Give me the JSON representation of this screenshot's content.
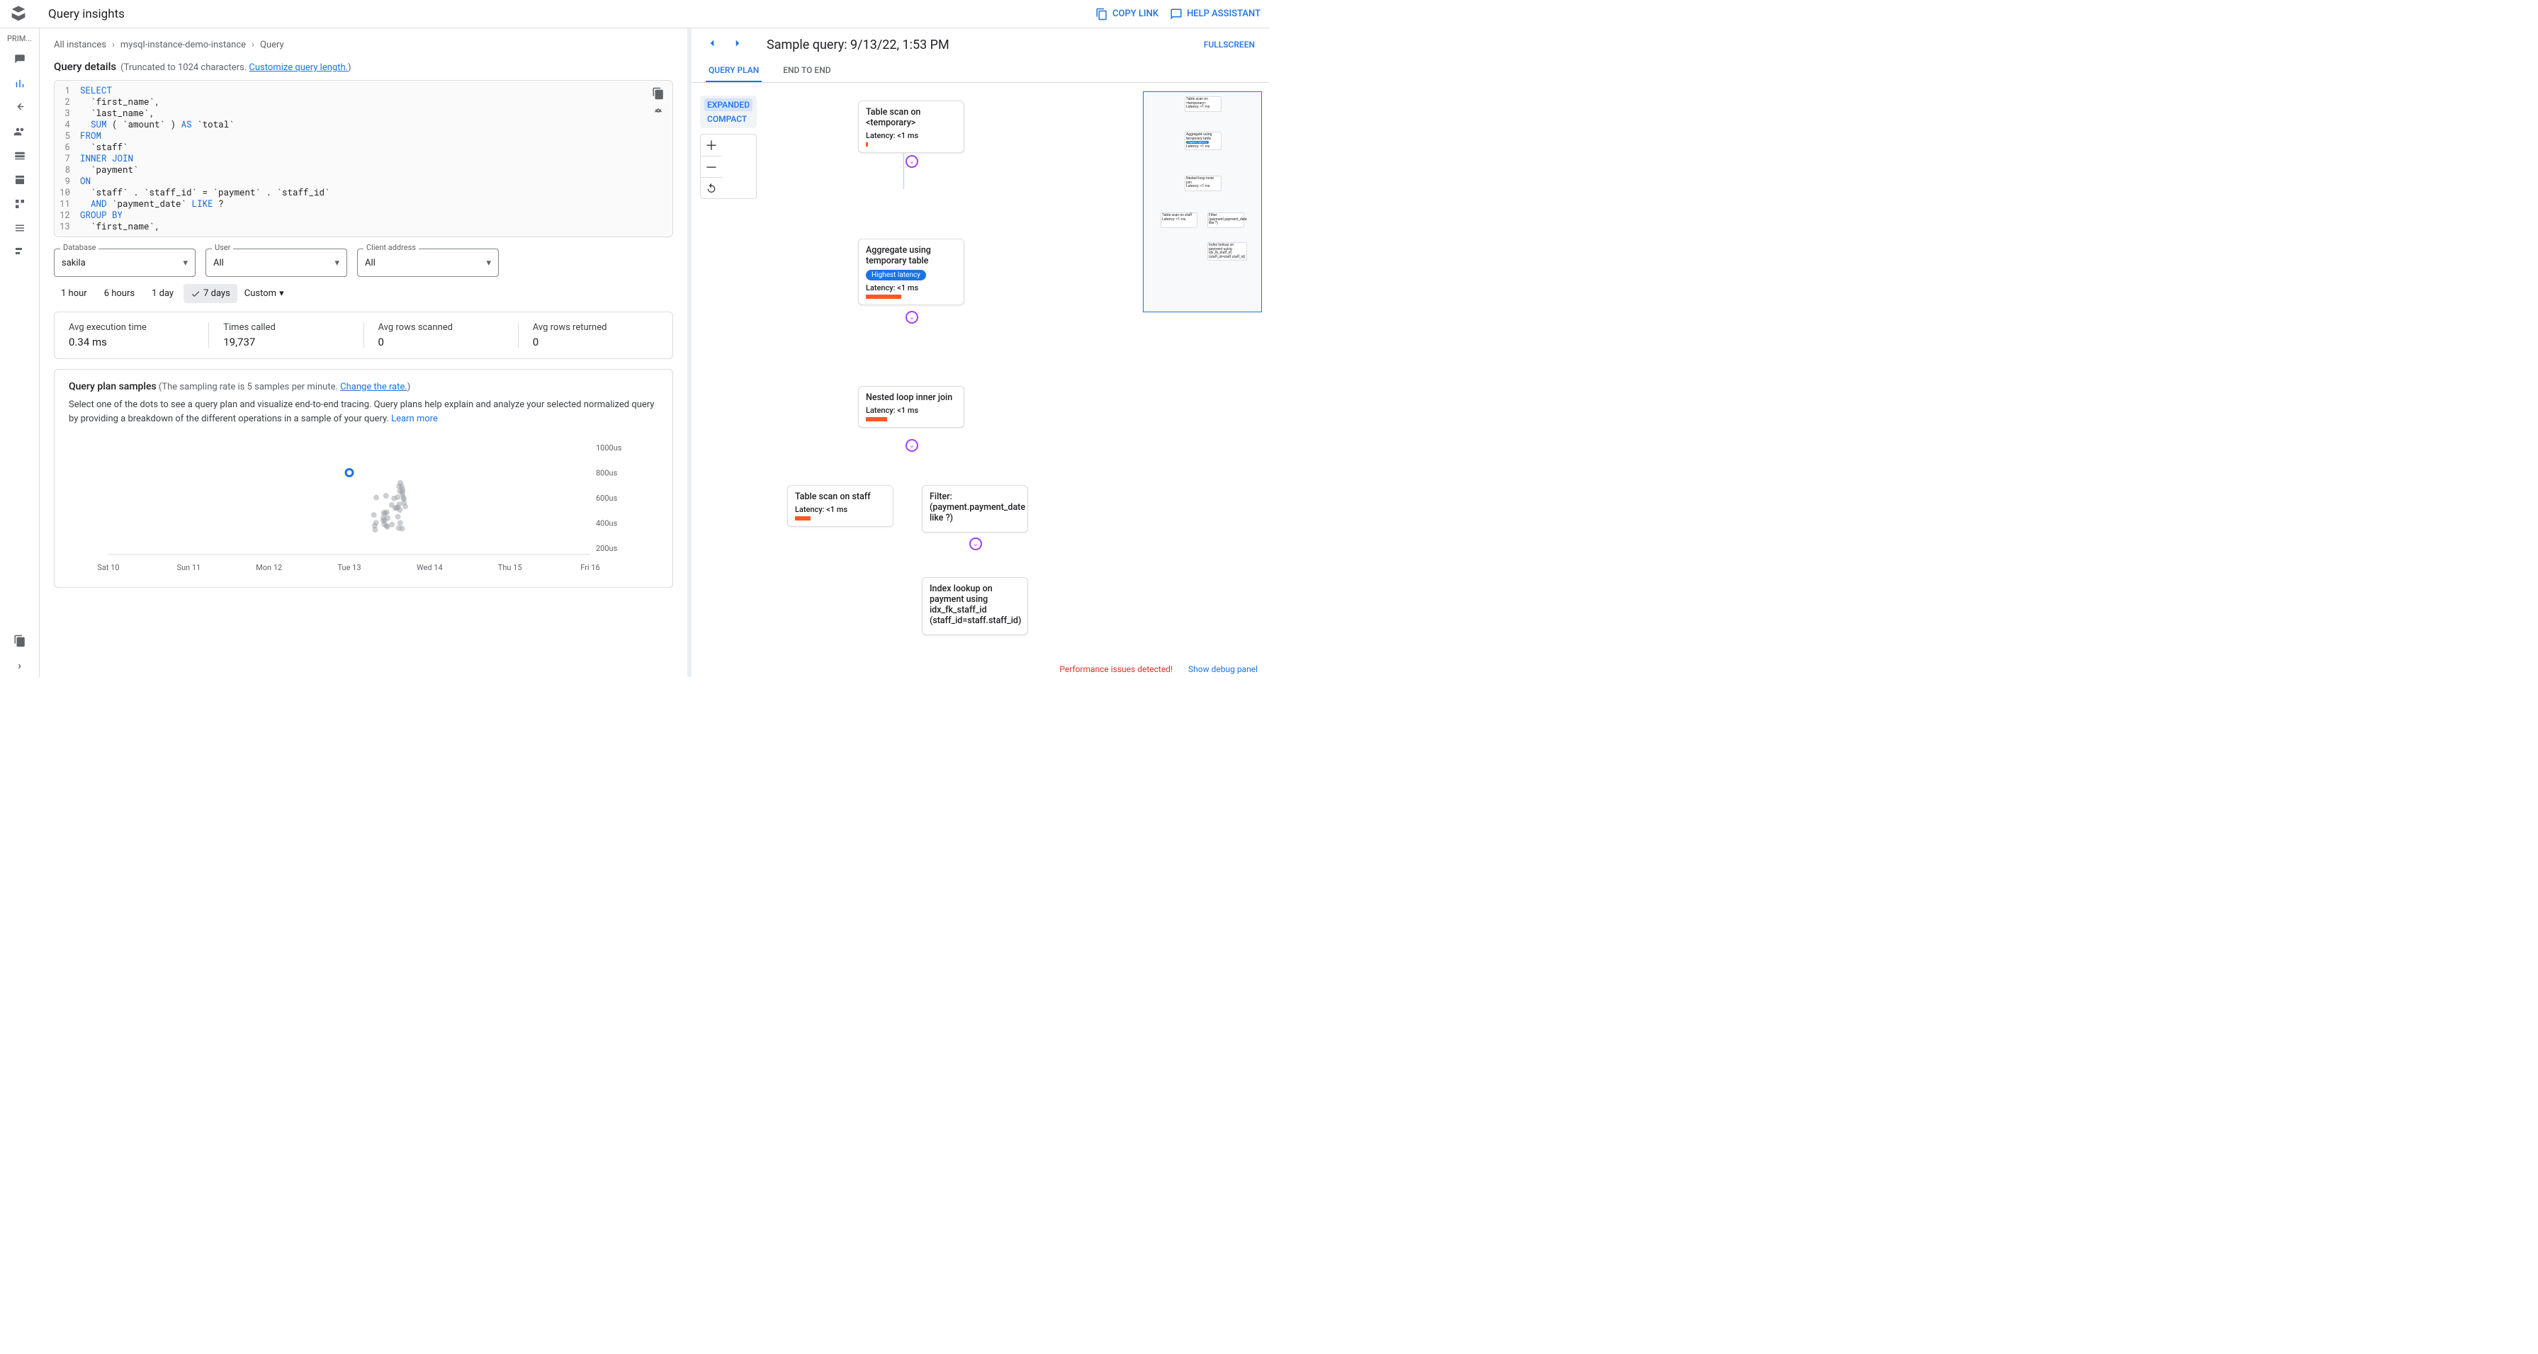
{
  "topbar": {
    "title": "Query insights",
    "copy": "COPY LINK",
    "help": "HELP ASSISTANT"
  },
  "sidebar": {
    "section": "PRIM...",
    "bottom_chev": "›"
  },
  "breadcrumb": {
    "all": "All instances",
    "inst": "mysql-instance-demo-instance",
    "q": "Query"
  },
  "qd": {
    "title": "Query details",
    "trunc": "(Truncated to 1024 characters. ",
    "customize": "Customize query length.",
    "close": ")"
  },
  "code": {
    "lines": [
      {
        "n": "1",
        "pre": "",
        "kw": "SELECT",
        "post": ""
      },
      {
        "n": "2",
        "pre": "  `first_name`,",
        "kw": "",
        "post": ""
      },
      {
        "n": "3",
        "pre": "  `last_name`,",
        "kw": "",
        "post": ""
      },
      {
        "n": "4",
        "pre": "  ",
        "kw": "SUM",
        "post": " ( `amount` ) ",
        "kw2": "AS",
        "post2": " `total`"
      },
      {
        "n": "5",
        "pre": "",
        "kw": "FROM",
        "post": ""
      },
      {
        "n": "6",
        "pre": "  `staff`",
        "kw": "",
        "post": ""
      },
      {
        "n": "7",
        "pre": "",
        "kw": "INNER JOIN",
        "post": ""
      },
      {
        "n": "8",
        "pre": "  `payment`",
        "kw": "",
        "post": ""
      },
      {
        "n": "9",
        "pre": "",
        "kw": "ON",
        "post": ""
      },
      {
        "n": "10",
        "pre": "  `staff` . `staff_id` = `payment` . `staff_id`",
        "kw": "",
        "post": ""
      },
      {
        "n": "11",
        "pre": "  ",
        "kw": "AND",
        "post": " `payment_date` ",
        "kw2": "LIKE",
        "post2": " ?"
      },
      {
        "n": "12",
        "pre": "",
        "kw": "GROUP BY",
        "post": ""
      },
      {
        "n": "13",
        "pre": "  `first_name`,",
        "kw": "",
        "post": ""
      }
    ]
  },
  "filters": {
    "db_label": "Database",
    "db_val": "sakila",
    "user_label": "User",
    "user_val": "All",
    "client_label": "Client address",
    "client_val": "All"
  },
  "timerow": {
    "h1": "1 hour",
    "h6": "6 hours",
    "d1": "1 day",
    "d7": "7 days",
    "custom": "Custom"
  },
  "stats": {
    "avg_exec_l": "Avg execution time",
    "avg_exec_v": "0.34 ms",
    "times_l": "Times called",
    "times_v": "19,737",
    "rows_scan_l": "Avg rows scanned",
    "rows_scan_v": "0",
    "rows_ret_l": "Avg rows returned",
    "rows_ret_v": "0"
  },
  "samples": {
    "title": "Query plan samples",
    "rate": "(The sampling rate is 5 samples per minute. ",
    "change": "Change the rate.",
    "rate_close": ")",
    "desc1": "Select one of the dots to see a query plan and visualize end-to-end tracing. Query plans help explain and analyze your selected normalized query by providing a breakdown of the different operations in a sample of your query. ",
    "learn": "Learn more"
  },
  "chart_data": {
    "type": "scatter",
    "x_categories": [
      "Sat 10",
      "Sun 11",
      "Mon 12",
      "Tue 13",
      "Wed 14",
      "Thu 15",
      "Fri 16"
    ],
    "ylabel": "",
    "y_unit": "us",
    "y_ticks": [
      200,
      400,
      600,
      800,
      1000
    ],
    "ylim": [
      150,
      1050
    ],
    "selected": {
      "x_index": 3,
      "y": 800
    },
    "cluster": {
      "x_index_range": [
        3.3,
        3.7
      ],
      "y_range": [
        300,
        740
      ],
      "approx_count": 40
    }
  },
  "rp": {
    "title": "Sample query: 9/13/22, 1:53 PM",
    "full": "FULLSCREEN",
    "tab_plan": "QUERY PLAN",
    "tab_e2e": "END TO END",
    "expanded": "EXPANDED",
    "compact": "COMPACT"
  },
  "nodes": {
    "n1": {
      "title": "Table scan on <temporary>",
      "lat": "Latency: <1 ms",
      "barw": "3px"
    },
    "n2": {
      "title": "Aggregate using temporary table",
      "badge": "Highest latency",
      "lat": "Latency: <1 ms",
      "barw": "50px"
    },
    "n3": {
      "title": "Nested loop inner join",
      "lat": "Latency: <1 ms",
      "barw": "30px"
    },
    "n4": {
      "title": "Table scan on staff",
      "lat": "Latency: <1 ms",
      "barw": "22px"
    },
    "n5": {
      "title": "Filter: (payment.payment_date like ?)",
      "lat": "",
      "barw": "0"
    },
    "n6": {
      "title": "Index lookup on payment using idx_fk_staff_id (staff_id=staff.staff_id)",
      "lat": "",
      "barw": "0"
    }
  },
  "footer": {
    "warn": "Performance issues detected!",
    "debug": "Show debug panel"
  }
}
